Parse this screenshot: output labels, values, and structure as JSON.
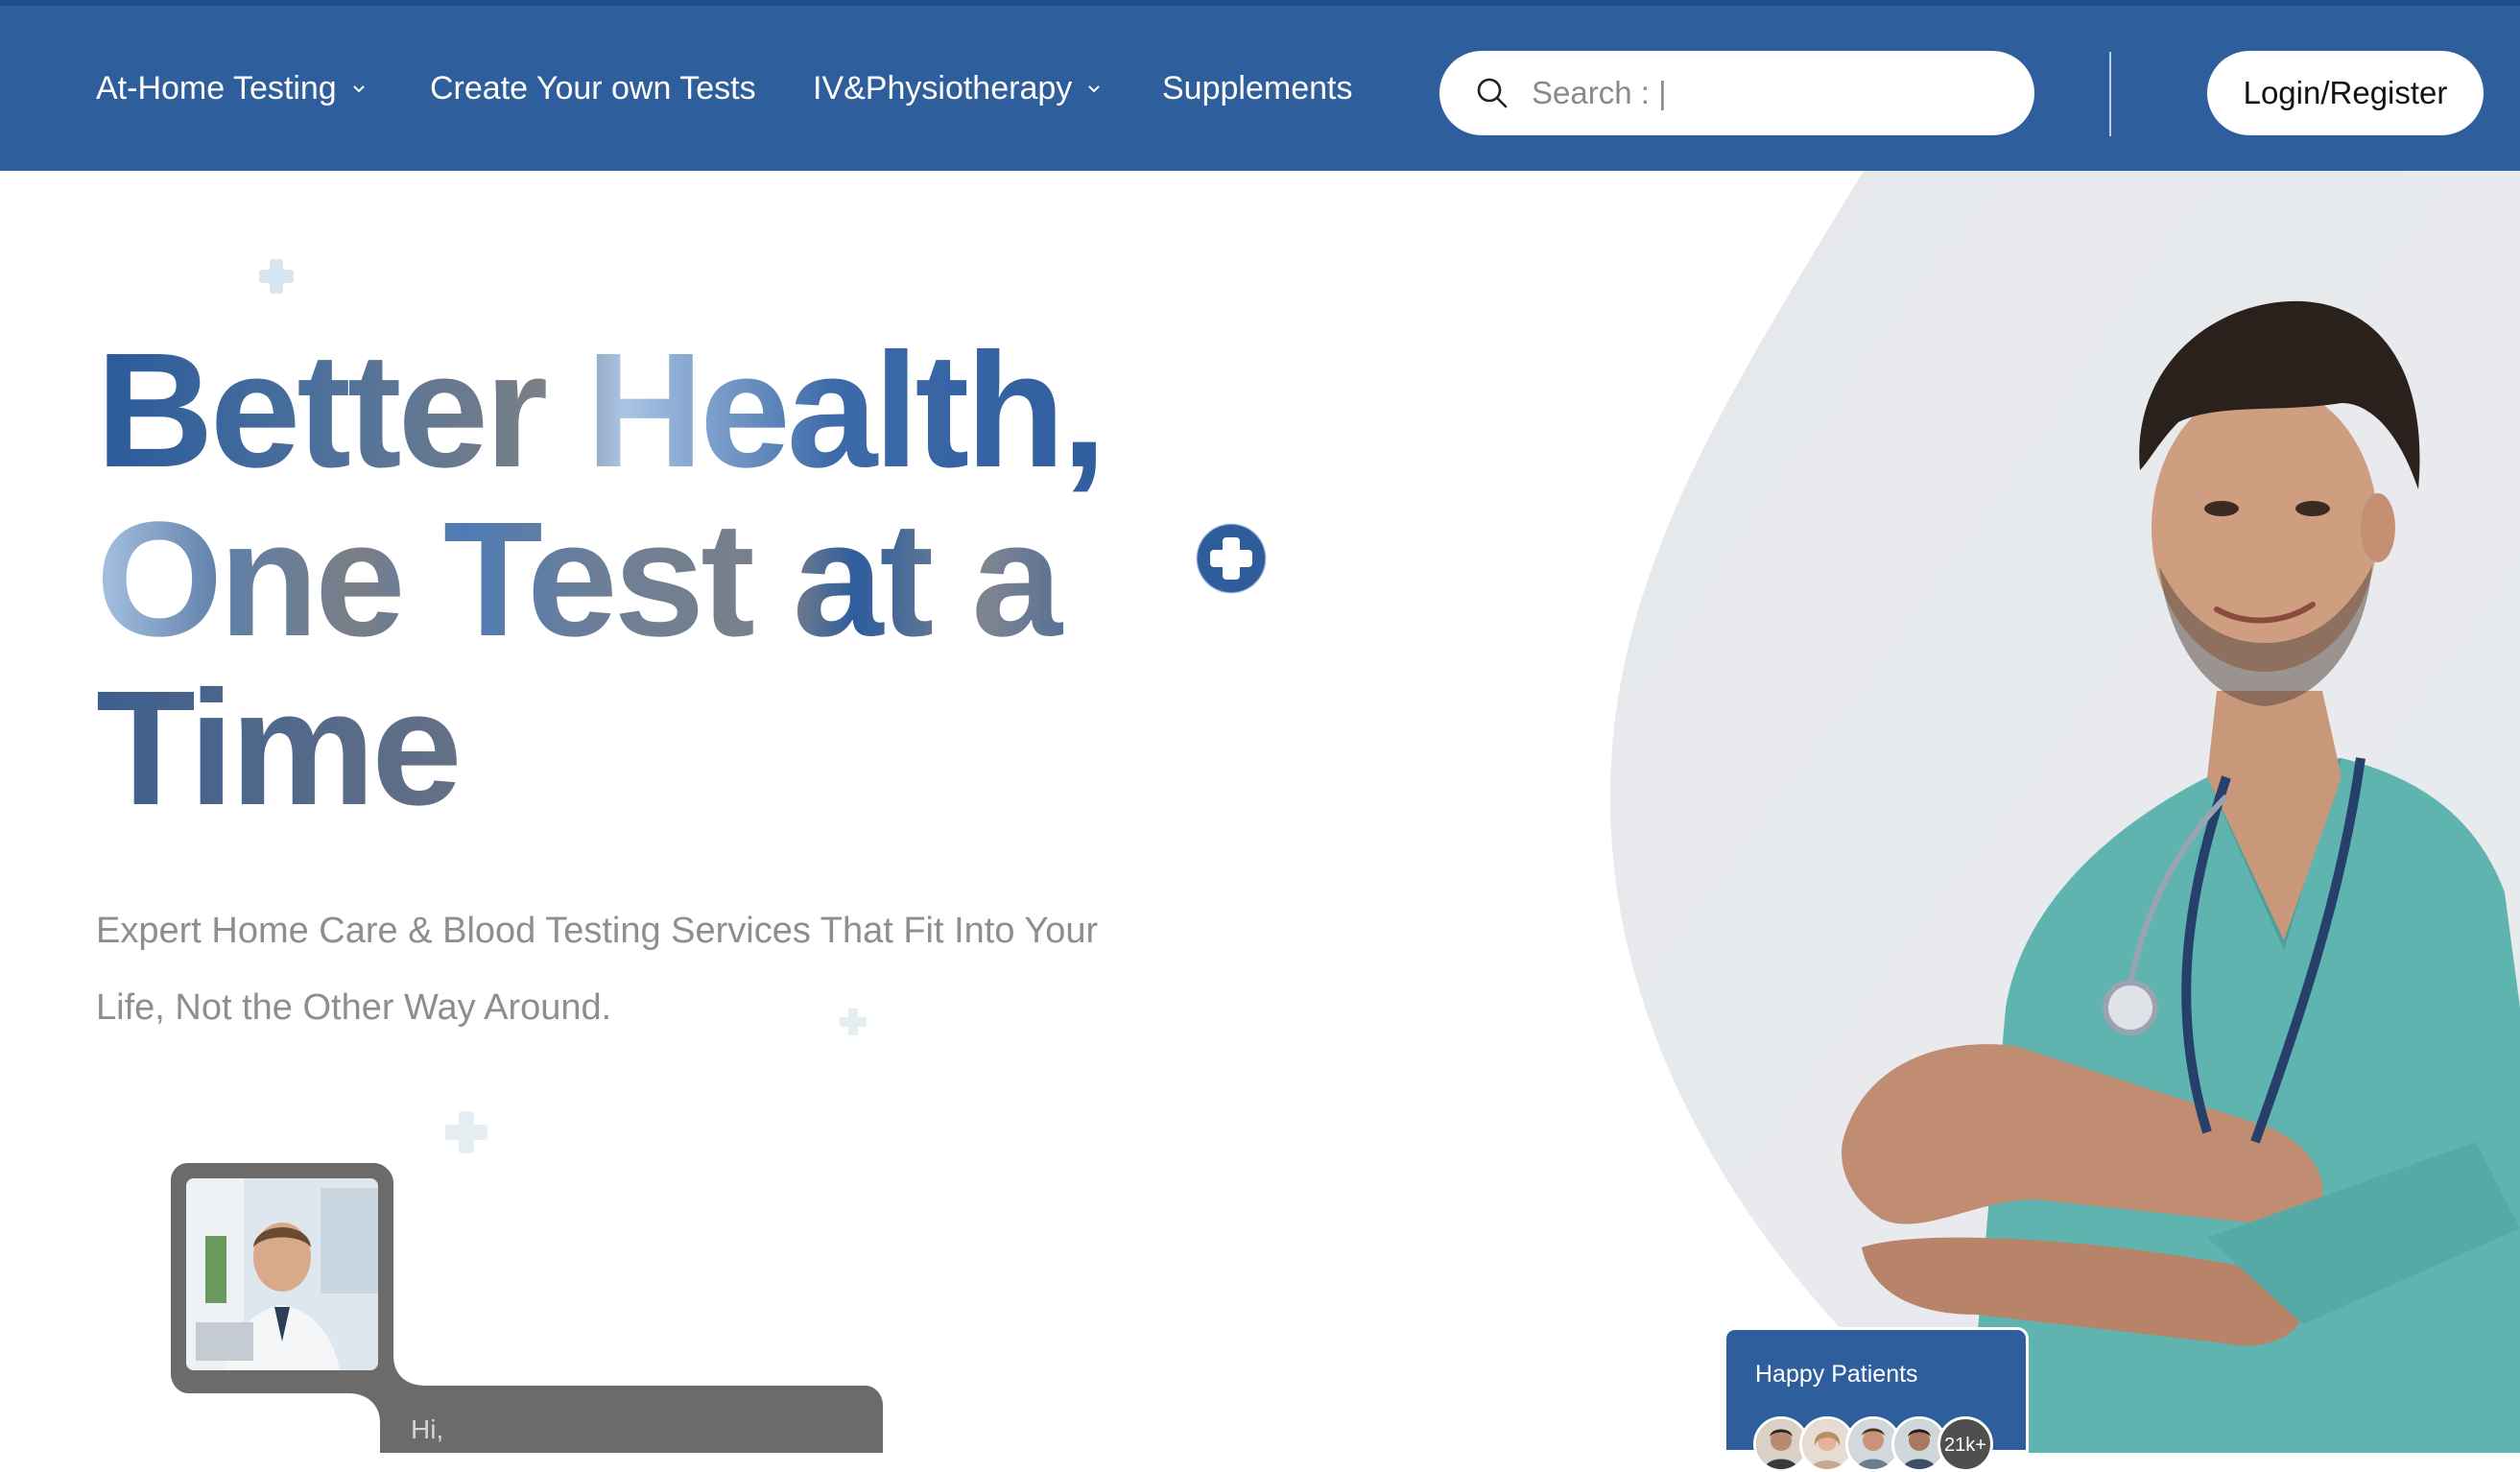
{
  "nav": {
    "items": [
      {
        "label": "At-Home Testing",
        "dropdown": true
      },
      {
        "label": "Create Your own Tests",
        "dropdown": false
      },
      {
        "label": "IV&Physiotherapy",
        "dropdown": true
      },
      {
        "label": "Supplements",
        "dropdown": false
      }
    ],
    "search_placeholder": "Search : |",
    "login_label": "Login/Register"
  },
  "hero": {
    "headline_line1": "Better Health,",
    "headline_line2": "One Test at a",
    "headline_line3": "Time",
    "subtitle": "Expert Home Care & Blood Testing Services That Fit Into Your Life, Not the Other Way Around."
  },
  "chat": {
    "greeting": "Hi,"
  },
  "happy_patients": {
    "label": "Happy Patients",
    "count": "21k+"
  },
  "colors": {
    "nav_bg": "#2e5e9b",
    "accent": "#2f5c9b",
    "subtitle": "#8e8e8e",
    "scrubs": "#5fb4b0"
  },
  "icons": [
    "chevron-down-icon",
    "search-icon",
    "plus-circle-icon",
    "plus-icon"
  ]
}
